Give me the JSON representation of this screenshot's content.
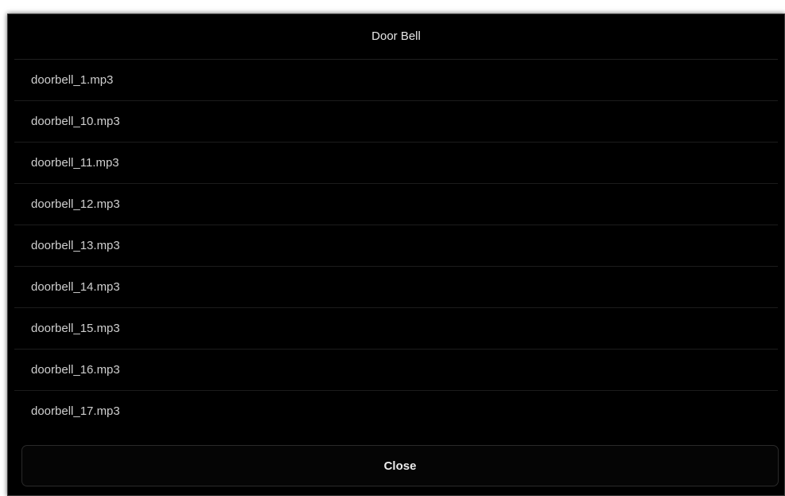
{
  "dialog": {
    "title": "Door Bell",
    "items": [
      {
        "label": "doorbell_1.mp3"
      },
      {
        "label": "doorbell_10.mp3"
      },
      {
        "label": "doorbell_11.mp3"
      },
      {
        "label": "doorbell_12.mp3"
      },
      {
        "label": "doorbell_13.mp3"
      },
      {
        "label": "doorbell_14.mp3"
      },
      {
        "label": "doorbell_15.mp3"
      },
      {
        "label": "doorbell_16.mp3"
      },
      {
        "label": "doorbell_17.mp3"
      }
    ],
    "close_label": "Close"
  },
  "colors": {
    "background": "#000000",
    "text": "#cfcfcf",
    "divider": "#1c1c1c"
  }
}
